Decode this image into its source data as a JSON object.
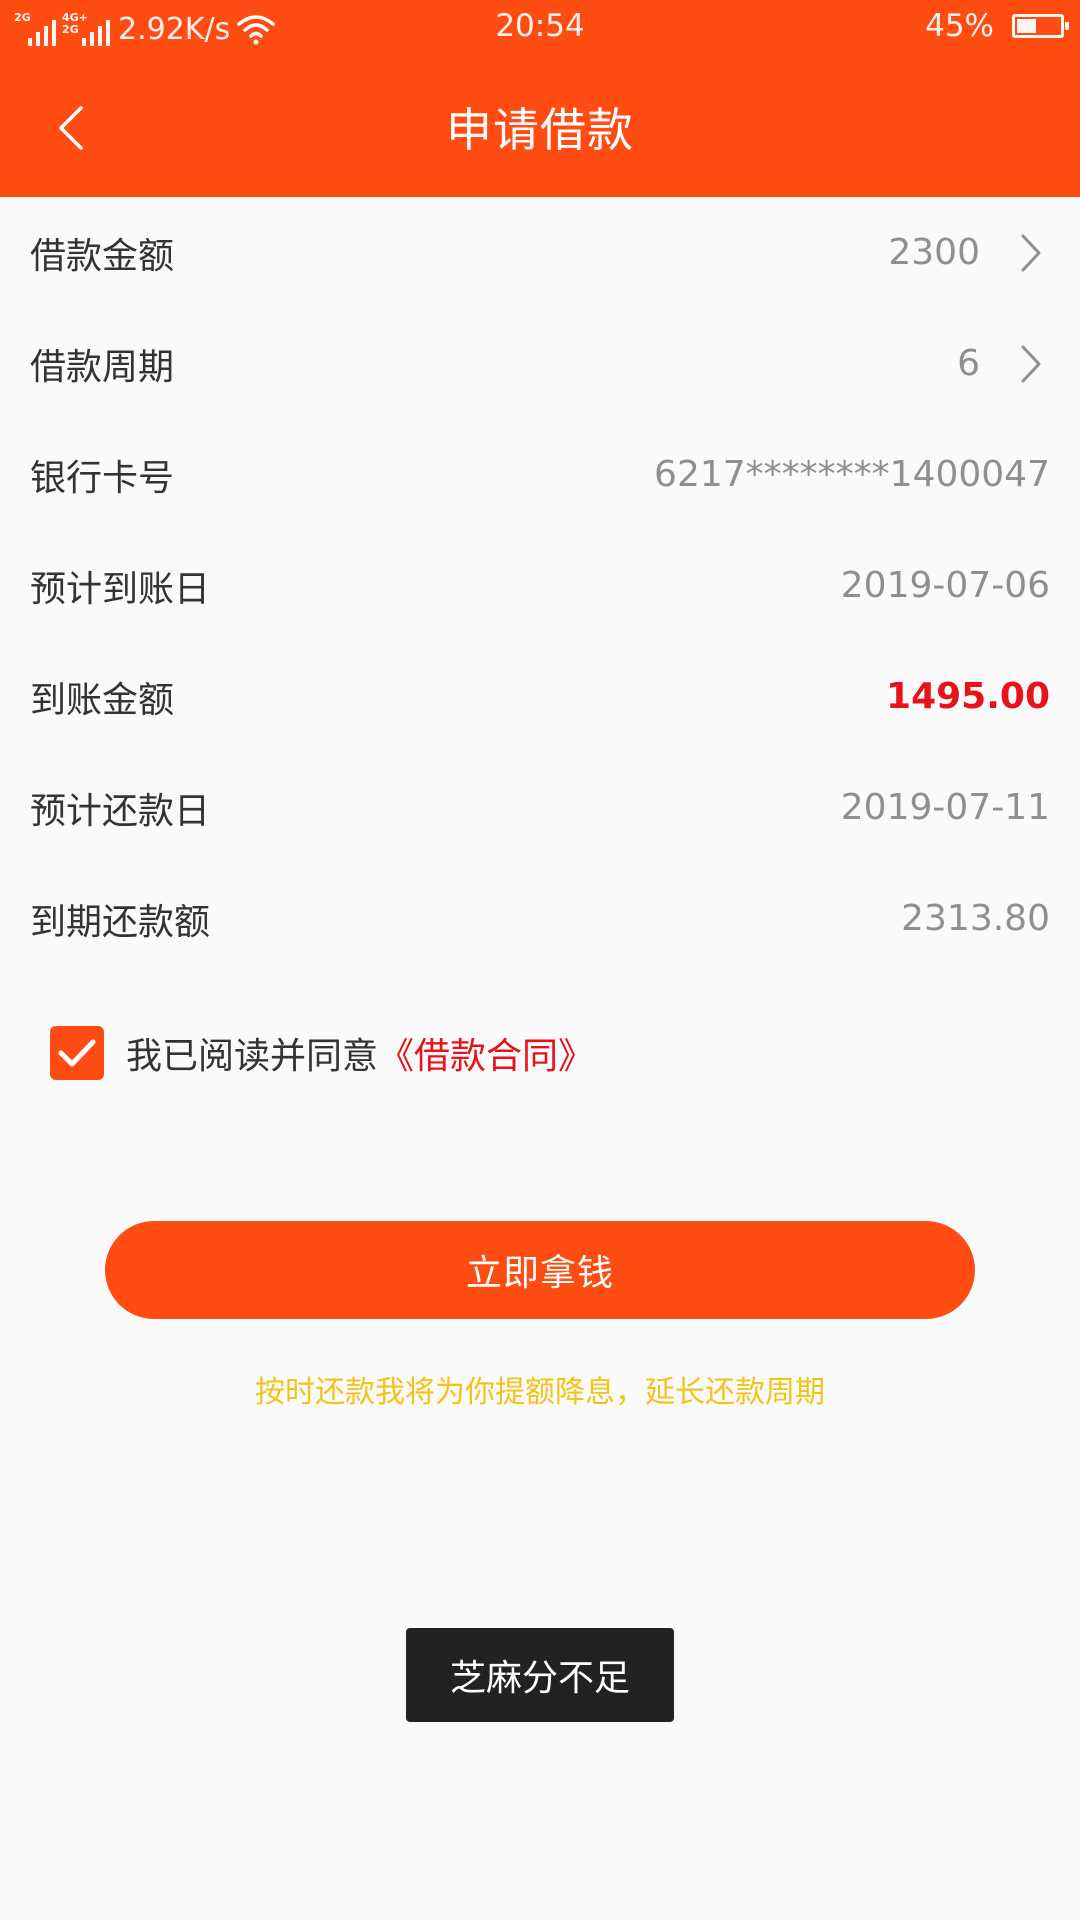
{
  "status_bar": {
    "net1": "2G",
    "net2_top": "4G+",
    "net2_bottom": "2G",
    "speed": "2.92K/s",
    "time": "20:54",
    "battery": "45%",
    "battery_level": 0.45
  },
  "header": {
    "title": "申请借款",
    "back_icon": "chevron-left-icon",
    "background": "#ff4c12"
  },
  "form": {
    "rows": [
      {
        "label": "借款金额",
        "value": "2300"
      },
      {
        "label": "借款周期",
        "value": "6"
      },
      {
        "label": "银行卡号",
        "value": "6217********1400047"
      },
      {
        "label": "预计到账日",
        "value": "2019-07-06"
      },
      {
        "label": "到账金额",
        "value": "1495.00"
      },
      {
        "label": "预计还款日",
        "value": "2019-07-11"
      },
      {
        "label": "到期还款额",
        "value": "2313.80"
      }
    ]
  },
  "agreement": {
    "checked": true,
    "text": "我已阅读并同意",
    "link": "《借款合同》"
  },
  "actions": {
    "submit_label": "立即拿钱",
    "tip": "按时还款我将为你提额降息，延长还款周期"
  },
  "toast": {
    "message": "芝麻分不足"
  },
  "colors": {
    "accent": "#ff4c12",
    "highlight": "#e8121a",
    "tip": "#f2c318",
    "toast_bg": "#222222"
  }
}
